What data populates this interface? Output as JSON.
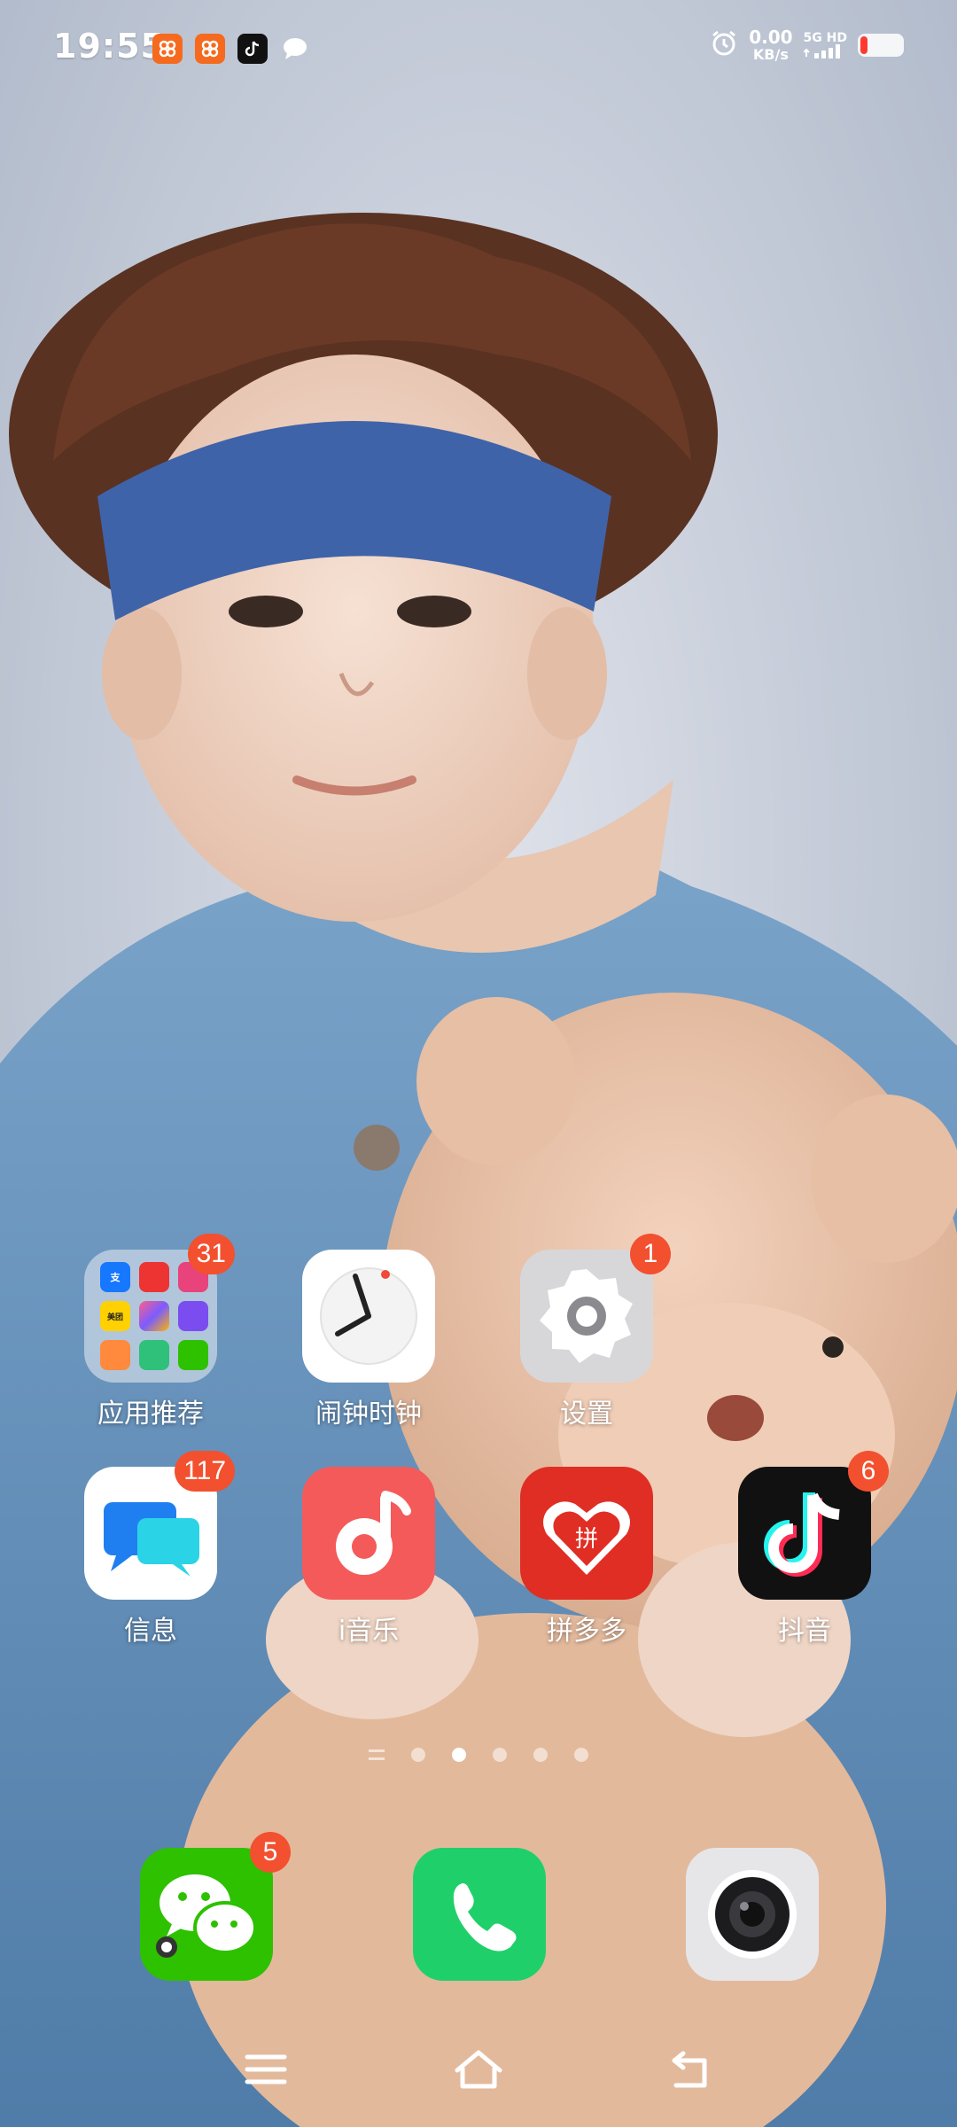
{
  "status_bar": {
    "time": "19:55",
    "net_speed_value": "0.00",
    "net_speed_unit": "KB/s",
    "network_type": "5G",
    "network_hd": "HD",
    "notification_icons": [
      "app-recommend-icon",
      "app-recommend-icon",
      "douyin-icon",
      "message-bubble-icon"
    ],
    "battery_color": "#ff3b30"
  },
  "home": {
    "apps": [
      {
        "label": "应用推荐",
        "badge": "31",
        "icon": "folder-icon"
      },
      {
        "label": "闹钟时钟",
        "badge": "",
        "icon": "clock-icon"
      },
      {
        "label": "设置",
        "badge": "1",
        "icon": "settings-gear-icon"
      },
      {
        "label": "信息",
        "badge": "117",
        "icon": "messages-icon"
      },
      {
        "label": "i音乐",
        "badge": "",
        "icon": "music-note-icon"
      },
      {
        "label": "拼多多",
        "badge": "",
        "icon": "pinduoduo-icon"
      },
      {
        "label": "抖音",
        "badge": "6",
        "icon": "douyin-icon"
      }
    ],
    "folder_mini_labels": [
      "支",
      "",
      "",
      "美团",
      "",
      "",
      "",
      "",
      ""
    ],
    "pages": 5,
    "active_page": 2
  },
  "dock": {
    "wechat_badge": "5",
    "apps": [
      "wechat-icon",
      "phone-icon",
      "camera-icon"
    ]
  },
  "colors": {
    "badge": "#f2502f",
    "wechat": "#2dc100",
    "phone": "#1fd06a",
    "music": "#f45a5a",
    "pinduoduo": "#e02e24"
  }
}
